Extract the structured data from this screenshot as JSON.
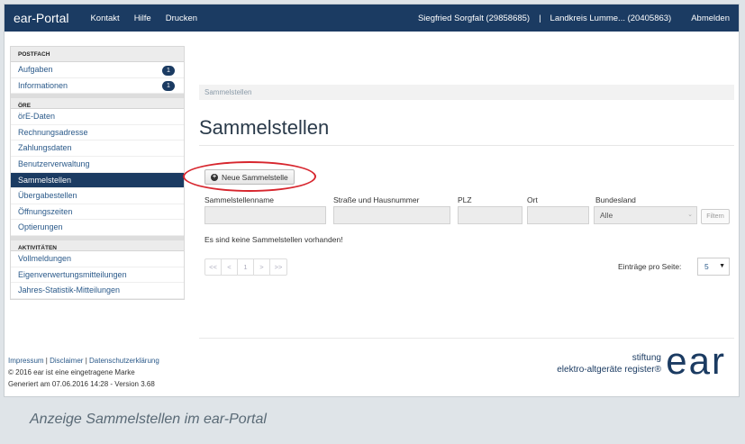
{
  "topbar": {
    "logo": "ear-Portal",
    "nav": [
      "Kontakt",
      "Hilfe",
      "Drucken"
    ],
    "user": "Siegfried Sorgfalt (29858685)",
    "separator": "|",
    "org": "Landkreis Lumme... (20405863)",
    "logout": "Abmelden"
  },
  "sidebar": {
    "sections": [
      {
        "heading": "POSTFACH",
        "items": [
          {
            "label": "Aufgaben",
            "badge": "1"
          },
          {
            "label": "Informationen",
            "badge": "1"
          }
        ]
      },
      {
        "heading": "ÖRE",
        "items": [
          {
            "label": "örE-Daten"
          },
          {
            "label": "Rechnungsadresse"
          },
          {
            "label": "Zahlungsdaten"
          },
          {
            "label": "Benutzerverwaltung"
          },
          {
            "label": "Sammelstellen",
            "active": true
          },
          {
            "label": "Übergabestellen"
          },
          {
            "label": "Öffnungszeiten"
          },
          {
            "label": "Optierungen"
          }
        ]
      },
      {
        "heading": "AKTIVITÄTEN",
        "items": [
          {
            "label": "Vollmeldungen"
          },
          {
            "label": "Eigenverwertungsmitteilungen"
          },
          {
            "label": "Jahres-Statistik-Mitteilungen"
          }
        ]
      }
    ]
  },
  "main": {
    "breadcrumb": "Sammelstellen",
    "title": "Sammelstellen",
    "new_button": "Neue Sammelstelle",
    "filter_labels": {
      "name": "Sammelstellenname",
      "street": "Straße und Hausnummer",
      "plz": "PLZ",
      "ort": "Ort",
      "bundesland": "Bundesland"
    },
    "bundesland_value": "Alle",
    "filter_button": "Filtern",
    "empty_message": "Es sind keine Sammelstellen vorhanden!",
    "pager": [
      "<<",
      "<",
      "1",
      ">",
      ">>"
    ],
    "per_page_label": "Einträge pro Seite:",
    "per_page_value": "5"
  },
  "footer": {
    "links": [
      "Impressum",
      "Disclaimer",
      "Datenschutzerklärung"
    ],
    "link_sep": "|",
    "trademark": "© 2016 ear ist eine eingetragene Marke",
    "generated": "Generiert am 07.06.2016 14:28 - Version 3.68",
    "brand_line1": "stiftung",
    "brand_line2": "elektro-altgeräte register®",
    "brand_logo": "ear"
  },
  "caption": "Anzeige Sammelstellen im ear-Portal",
  "colors": {
    "nav": "#1b3b62",
    "highlight_circle": "#d7262e",
    "link": "#2b5a8a"
  }
}
